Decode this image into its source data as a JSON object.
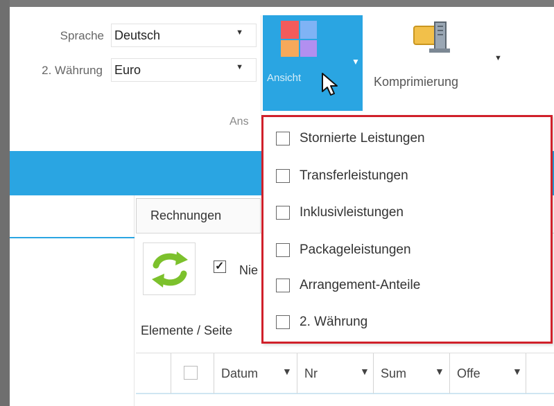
{
  "ribbon": {
    "language_label": "Sprache",
    "language_value": "Deutsch",
    "currency_label": "2. Währung",
    "currency_value": "Euro",
    "view_button_label": "Ansicht",
    "compress_label": "Komprimierung",
    "group_label": "Ans"
  },
  "tabs": {
    "rechnungen": "Rechnungen"
  },
  "toolbar": {
    "nie_checkbox_label": "Nie",
    "nie_checked": true,
    "elements_label": "Elemente / Seite"
  },
  "grid": {
    "columns": [
      "Datum",
      "Nr",
      "Sum",
      "Offe"
    ]
  },
  "popup": {
    "items": [
      {
        "label": "Stornierte Leistungen",
        "checked": false
      },
      {
        "label": "Transferleistungen",
        "checked": false
      },
      {
        "label": "Inklusivleistungen",
        "checked": false
      },
      {
        "label": "Packageleistungen",
        "checked": false
      },
      {
        "label": "Arrangement-Anteile",
        "checked": false
      },
      {
        "label": "2. Währung",
        "checked": false
      }
    ]
  },
  "colors": {
    "accent": "#2aa5e2",
    "highlight_border": "#d0202a",
    "tile_colors": [
      "#f35b5b",
      "#7fb3f5",
      "#f6a95b",
      "#b28ff0"
    ]
  },
  "icons": {
    "view": "tiles-icon",
    "compress": "compress-icon",
    "refresh": "refresh-icon",
    "filter": "filter-icon",
    "cursor": "mouse-cursor-icon"
  }
}
